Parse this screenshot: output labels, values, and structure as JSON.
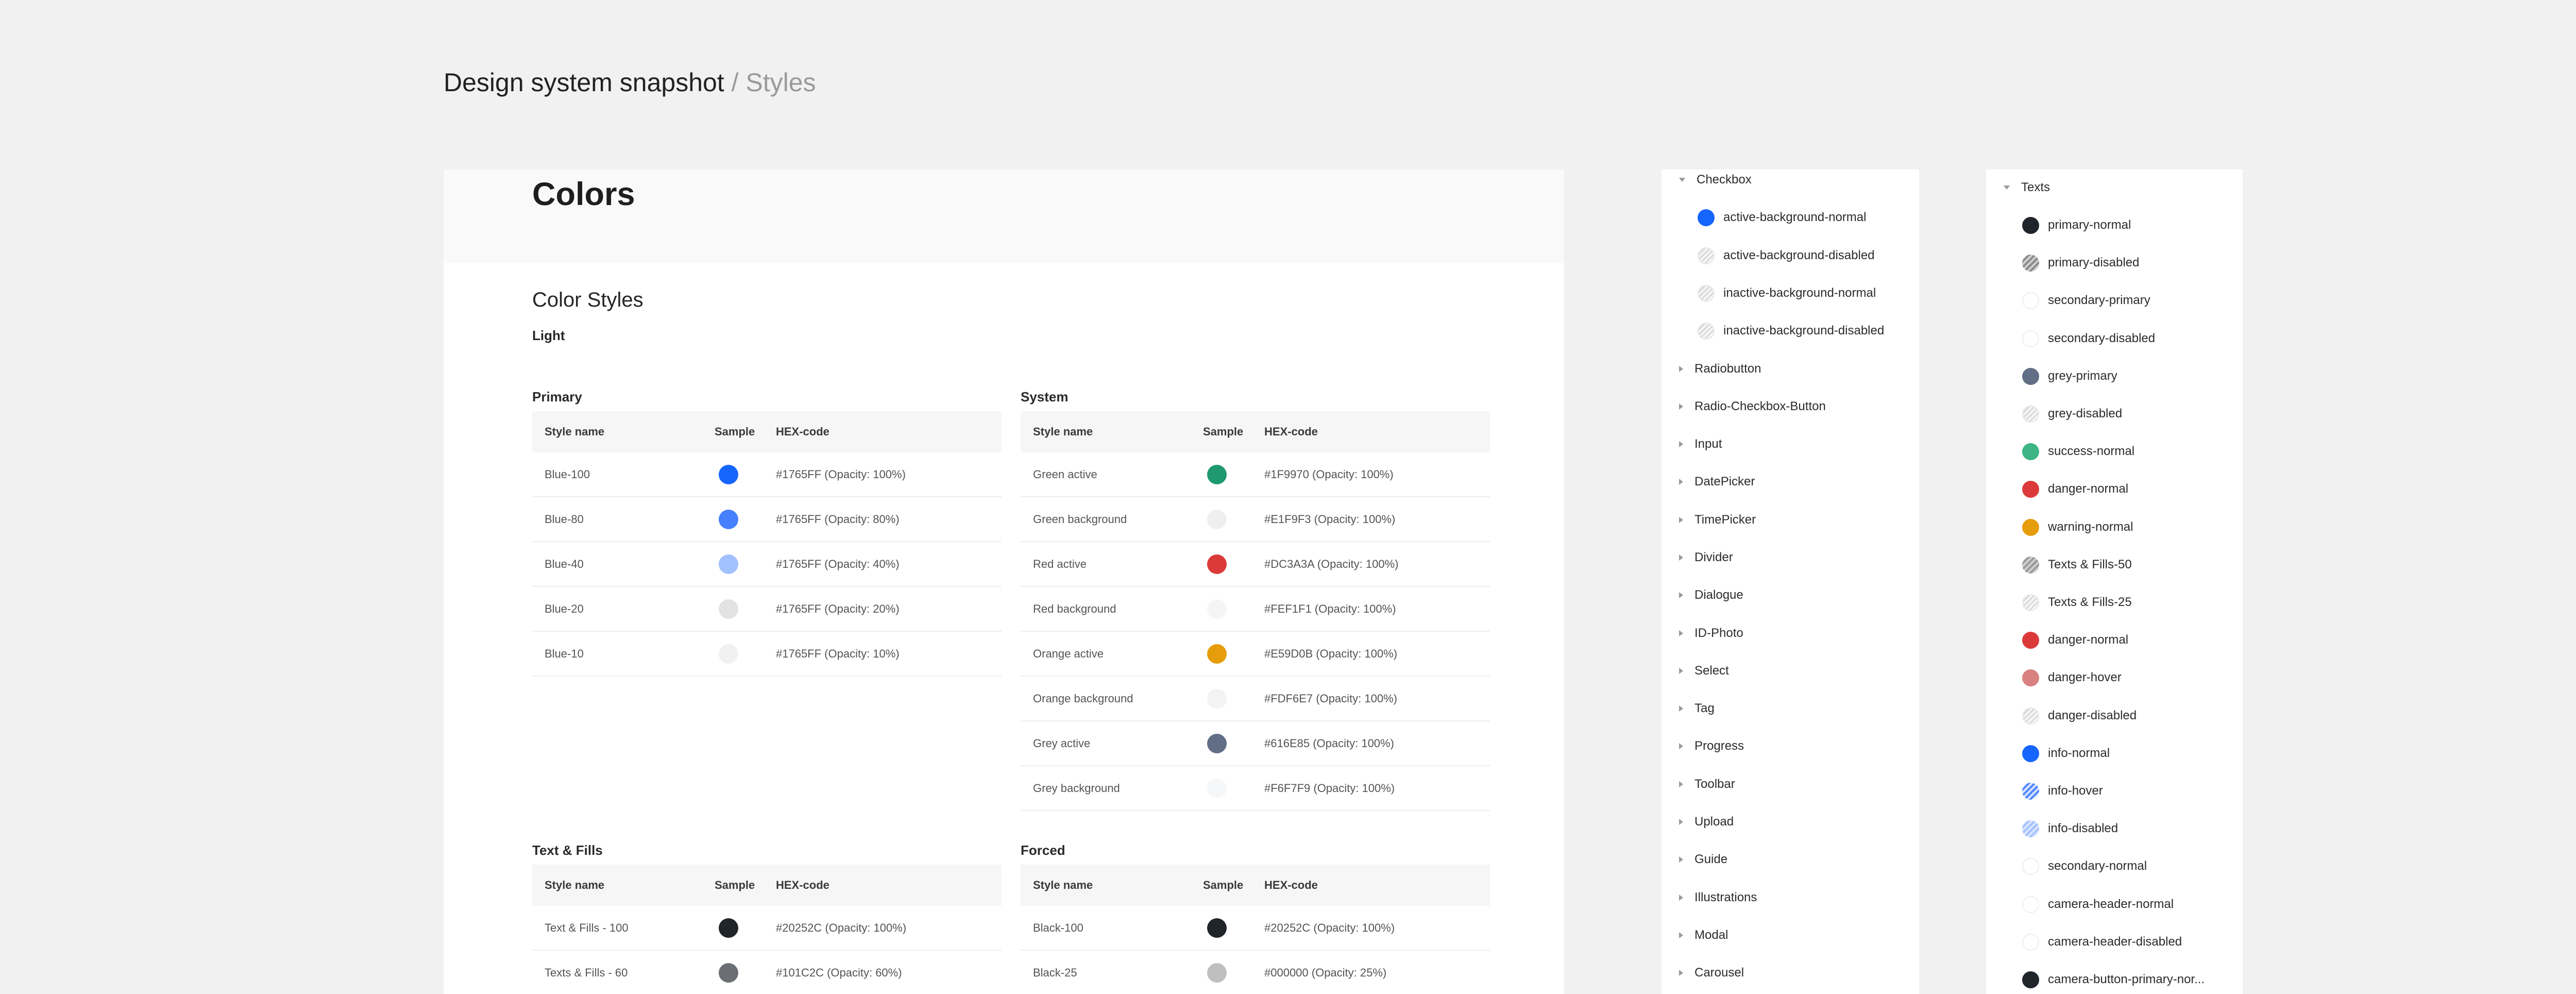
{
  "page": {
    "title": "Design system snapshot",
    "title_suffix": " / Styles"
  },
  "main": {
    "heading": "Colors",
    "section_title": "Color Styles",
    "theme_label": "Light",
    "column_headers": {
      "style_name": "Style name",
      "sample": "Sample",
      "hex": "HEX-code"
    },
    "tables": [
      {
        "title": "Primary",
        "rows": [
          {
            "name": "Blue-100",
            "color": "#1765FF",
            "hex": "#1765FF (Opacity: 100%)"
          },
          {
            "name": "Blue-80",
            "color": "#4680FF",
            "hex": "#1765FF (Opacity: 80%)"
          },
          {
            "name": "Blue-40",
            "color": "#A2C1FF",
            "hex": "#1765FF (Opacity: 40%)"
          },
          {
            "name": "Blue-20",
            "color": "#E3E3E3",
            "hex": "#1765FF (Opacity: 20%)"
          },
          {
            "name": "Blue-10",
            "color": "#F1F1F1",
            "hex": "#1765FF (Opacity: 10%)"
          }
        ]
      },
      {
        "title": "System",
        "rows": [
          {
            "name": "Green active",
            "color": "#1F9970",
            "hex": "#1F9970 (Opacity: 100%)"
          },
          {
            "name": "Green background",
            "color": "#EFEFEF",
            "hex": "#E1F9F3 (Opacity: 100%)"
          },
          {
            "name": "Red active",
            "color": "#DC3A3A",
            "hex": "#DC3A3A (Opacity: 100%)"
          },
          {
            "name": "Red background",
            "color": "#F5F5F5",
            "hex": "#FEF1F1 (Opacity: 100%)"
          },
          {
            "name": "Orange active",
            "color": "#E59D0B",
            "hex": "#E59D0B (Opacity: 100%)"
          },
          {
            "name": "Orange background",
            "color": "#F3F3F3",
            "hex": "#FDF6E7 (Opacity: 100%)"
          },
          {
            "name": "Grey active",
            "color": "#616E85",
            "hex": "#616E85 (Opacity: 100%)"
          },
          {
            "name": "Grey background",
            "color": "#F6F7F9",
            "hex": "#F6F7F9 (Opacity: 100%)"
          }
        ]
      },
      {
        "title": "Text & Fills",
        "rows": [
          {
            "name": "Text & Fills - 100",
            "color": "#20252C",
            "hex": "#20252C (Opacity: 100%)"
          },
          {
            "name": "Texts & Fills - 60",
            "color": "#6B6E72",
            "hex": "#101C2C (Opacity: 60%)"
          }
        ]
      },
      {
        "title": "Forced",
        "rows": [
          {
            "name": "Black-100",
            "color": "#20252C",
            "hex": "#20252C (Opacity: 100%)"
          },
          {
            "name": "Black-25",
            "color": "#BFBFBF",
            "hex": "#000000 (Opacity: 25%)"
          }
        ]
      }
    ]
  },
  "components_panel": {
    "items": [
      {
        "label": "Checkbox",
        "expanded": true,
        "children": [
          {
            "label": "active-background-normal",
            "color": "#1765FF",
            "kind": "solid"
          },
          {
            "label": "active-background-disabled",
            "kind": "pattern"
          },
          {
            "label": "inactive-background-normal",
            "kind": "pattern"
          },
          {
            "label": "inactive-background-disabled",
            "kind": "pattern"
          }
        ]
      },
      {
        "label": "Radiobutton"
      },
      {
        "label": "Radio-Checkbox-Button"
      },
      {
        "label": "Input"
      },
      {
        "label": "DatePicker"
      },
      {
        "label": "TimePicker"
      },
      {
        "label": "Divider"
      },
      {
        "label": "Dialogue"
      },
      {
        "label": "ID-Photo"
      },
      {
        "label": "Select"
      },
      {
        "label": "Tag"
      },
      {
        "label": "Progress"
      },
      {
        "label": "Toolbar"
      },
      {
        "label": "Upload"
      },
      {
        "label": "Guide"
      },
      {
        "label": "Illustrations"
      },
      {
        "label": "Modal"
      },
      {
        "label": "Carousel"
      }
    ]
  },
  "texts_panel": {
    "group_label": "Texts",
    "items": [
      {
        "label": "primary-normal",
        "color": "#20252C",
        "kind": "solid"
      },
      {
        "label": "primary-disabled",
        "color": "#8A8A8A",
        "kind": "pattern-dark"
      },
      {
        "label": "secondary-primary",
        "kind": "empty"
      },
      {
        "label": "secondary-disabled",
        "kind": "empty"
      },
      {
        "label": "grey-primary",
        "color": "#616E85",
        "kind": "solid"
      },
      {
        "label": "grey-disabled",
        "kind": "pattern"
      },
      {
        "label": "success-normal",
        "color": "#3DB585",
        "kind": "solid"
      },
      {
        "label": "danger-normal",
        "color": "#DC3A3A",
        "kind": "solid"
      },
      {
        "label": "warning-normal",
        "color": "#E59D0B",
        "kind": "solid"
      },
      {
        "label": "Texts & Fills-50",
        "color": "#9A9A9A",
        "kind": "pattern-dark"
      },
      {
        "label": "Texts & Fills-25",
        "kind": "pattern"
      },
      {
        "label": "danger-normal",
        "color": "#DC3A3A",
        "kind": "solid"
      },
      {
        "label": "danger-hover",
        "color": "#D98080",
        "kind": "solid"
      },
      {
        "label": "danger-disabled",
        "kind": "pattern"
      },
      {
        "label": "info-normal",
        "color": "#1765FF",
        "kind": "solid"
      },
      {
        "label": "info-hover",
        "color": "#4F86FF",
        "kind": "pattern-blue"
      },
      {
        "label": "info-disabled",
        "color": "#A2C1FF",
        "kind": "pattern-blue"
      },
      {
        "label": "secondary-normal",
        "kind": "empty"
      },
      {
        "label": "camera-header-normal",
        "kind": "empty"
      },
      {
        "label": "camera-header-disabled",
        "kind": "empty"
      },
      {
        "label": "camera-button-primary-nor...",
        "color": "#20252C",
        "kind": "solid"
      }
    ]
  }
}
